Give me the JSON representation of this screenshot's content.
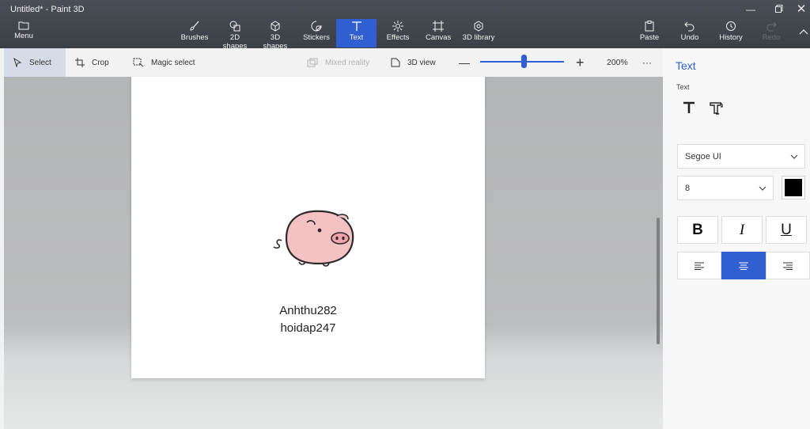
{
  "window": {
    "title": "Untitled* - Paint 3D"
  },
  "ribbon": {
    "menu": "Menu",
    "tools": [
      {
        "label": "Brushes",
        "icon": "brush-icon"
      },
      {
        "label": "2D shapes",
        "icon": "2d-shapes-icon"
      },
      {
        "label": "3D shapes",
        "icon": "3d-shapes-icon"
      },
      {
        "label": "Stickers",
        "icon": "stickers-icon"
      },
      {
        "label": "Text",
        "icon": "text-icon",
        "active": true
      },
      {
        "label": "Effects",
        "icon": "effects-icon"
      },
      {
        "label": "Canvas",
        "icon": "canvas-icon"
      },
      {
        "label": "3D library",
        "icon": "3d-library-icon"
      }
    ],
    "paste": "Paste",
    "undo": "Undo",
    "history": "History",
    "redo": "Redo"
  },
  "toolbar": {
    "select": "Select",
    "crop": "Crop",
    "magic_select": "Magic select",
    "mixed_reality": "Mixed reality",
    "view_3d": "3D view",
    "zoom": "200%",
    "zoom_level": 0.52,
    "more": "···"
  },
  "canvas": {
    "line1": "Anhthu282",
    "line2": "hoidap247",
    "sticker": "pig-sticker"
  },
  "panel": {
    "title": "Text",
    "section_label": "Text",
    "font": "Segoe UI",
    "size": "8",
    "color": "#000000",
    "bold": "B",
    "italic": "I",
    "underline": "U",
    "alignment": "center"
  },
  "colors": {
    "accent": "#2f5fd0",
    "titlebar": "#3b3f46",
    "canvas": "#ffffff"
  }
}
